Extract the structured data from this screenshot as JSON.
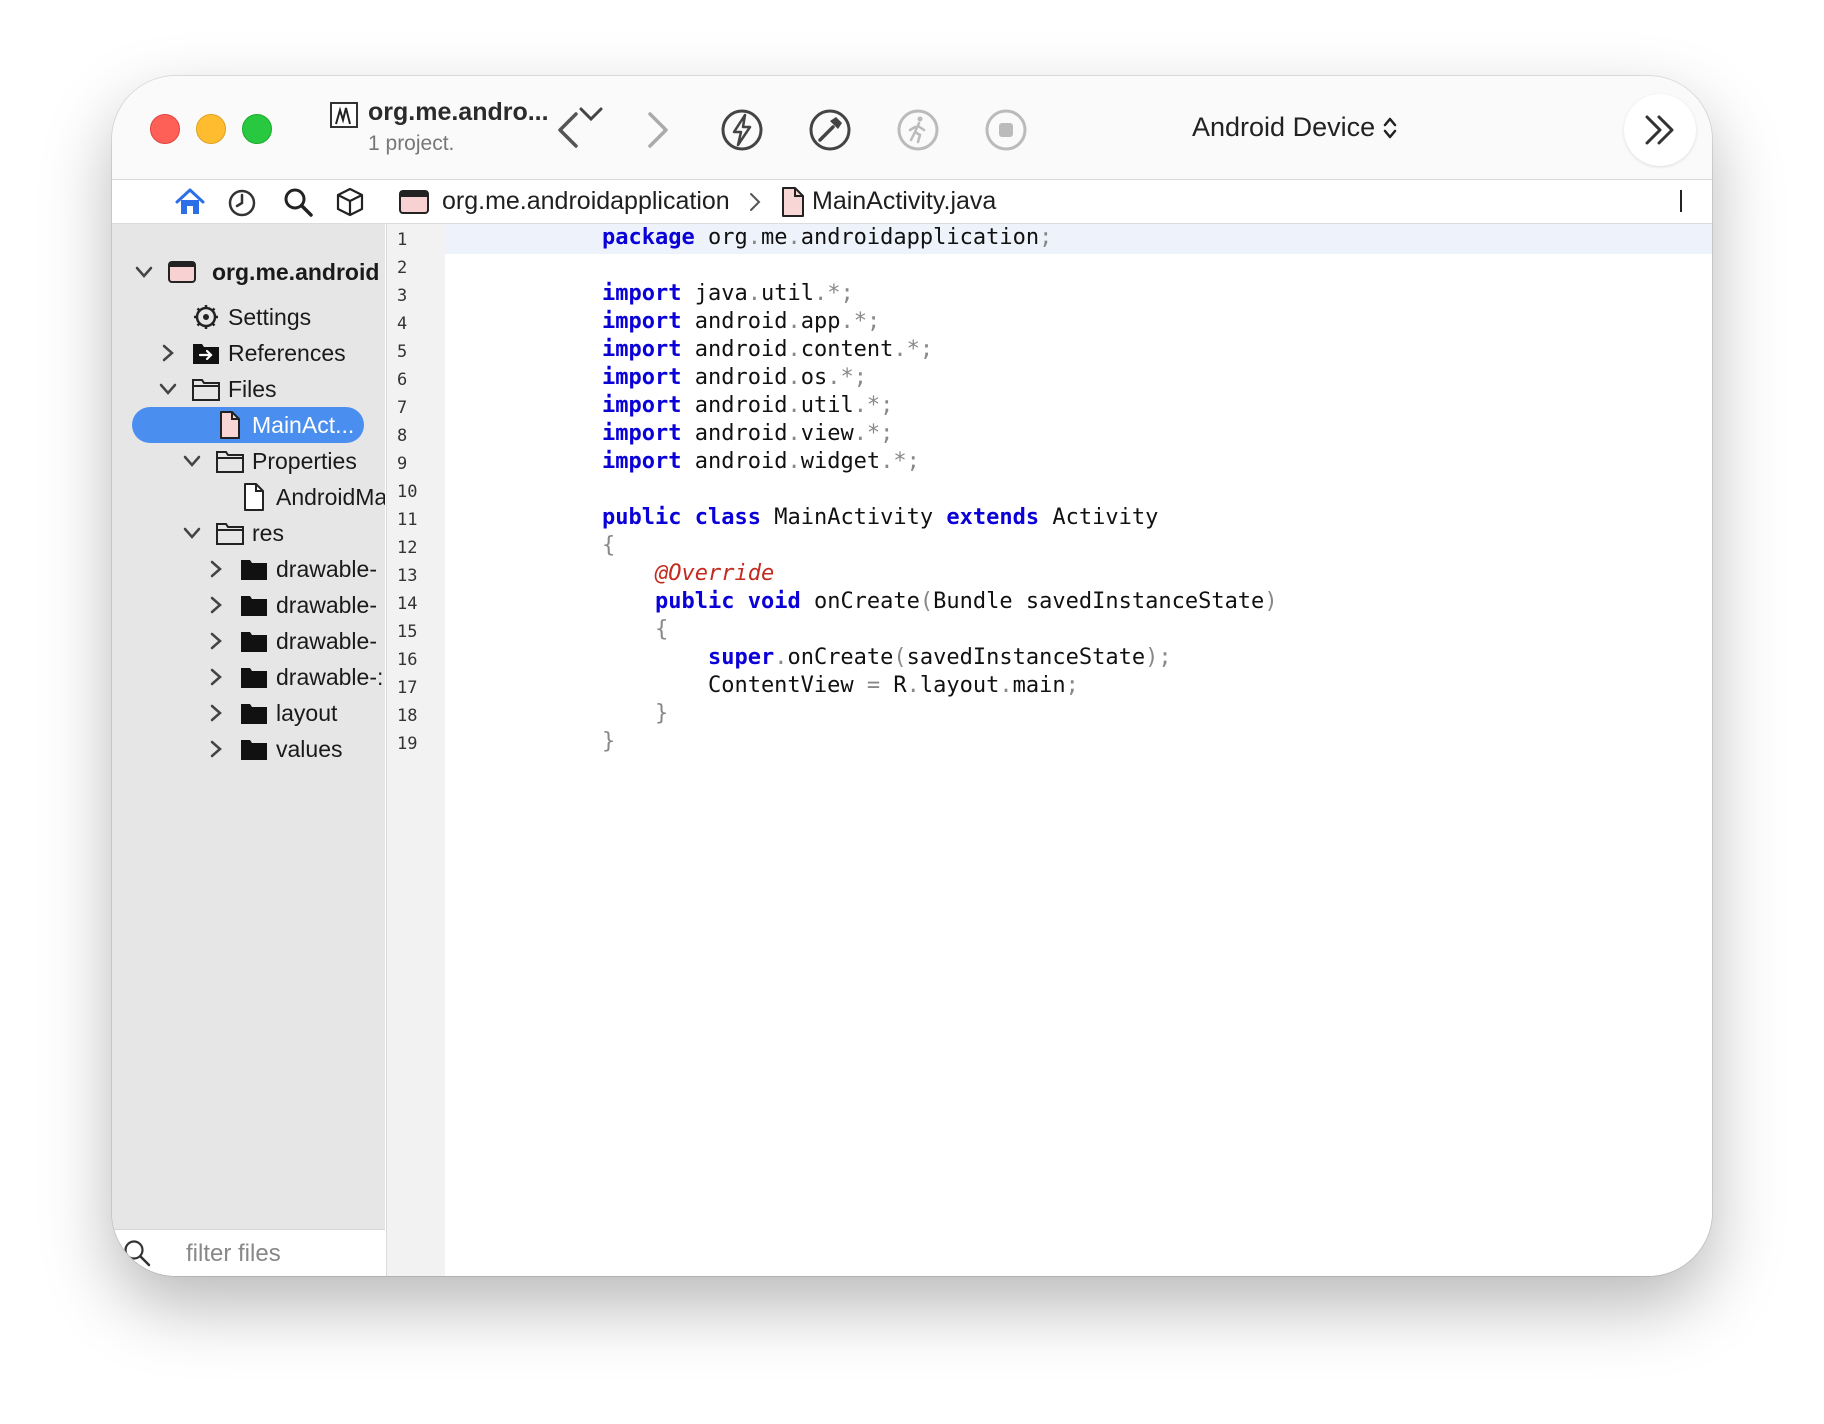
{
  "toolbar": {
    "project_name": "org.me.andro...",
    "project_subtitle": "1 project.",
    "device": "Android Device"
  },
  "breadcrumb": {
    "project": "org.me.androidapplication",
    "file": "MainActivity.java"
  },
  "sidebar": {
    "root": "org.me.android",
    "items": [
      {
        "label": "Settings"
      },
      {
        "label": "References"
      },
      {
        "label": "Files"
      },
      {
        "label": "MainAct..."
      },
      {
        "label": "Properties"
      },
      {
        "label": "AndroidMa"
      },
      {
        "label": "res"
      },
      {
        "label": "drawable-"
      },
      {
        "label": "drawable-"
      },
      {
        "label": "drawable-"
      },
      {
        "label": "drawable-:"
      },
      {
        "label": "layout"
      },
      {
        "label": "values"
      }
    ],
    "filter_placeholder": "filter files"
  },
  "editor": {
    "line_numbers": [
      "1",
      "2",
      "3",
      "4",
      "5",
      "6",
      "7",
      "8",
      "9",
      "10",
      "11",
      "12",
      "13",
      "14",
      "15",
      "16",
      "17",
      "18",
      "19"
    ],
    "code": {
      "l1": {
        "a": "package",
        "b": " org",
        "c": ".",
        "d": "me",
        "e": ".",
        "f": "androidapplication",
        "g": ";"
      },
      "l3": {
        "a": "import",
        "b": " java",
        "c": ".",
        "d": "util",
        "e": ".*;"
      },
      "l4": {
        "a": "import",
        "b": " android",
        "c": ".",
        "d": "app",
        "e": ".*;"
      },
      "l5": {
        "a": "import",
        "b": " android",
        "c": ".",
        "d": "content",
        "e": ".*;"
      },
      "l6": {
        "a": "import",
        "b": " android",
        "c": ".",
        "d": "os",
        "e": ".*;"
      },
      "l7": {
        "a": "import",
        "b": " android",
        "c": ".",
        "d": "util",
        "e": ".*;"
      },
      "l8": {
        "a": "import",
        "b": " android",
        "c": ".",
        "d": "view",
        "e": ".*;"
      },
      "l9": {
        "a": "import",
        "b": " android",
        "c": ".",
        "d": "widget",
        "e": ".*;"
      },
      "l11": {
        "a": "public",
        "b": " ",
        "c": "class",
        "d": " MainActivity ",
        "e": "extends",
        "f": " Activity"
      },
      "l12": {
        "a": "{"
      },
      "l13": {
        "a": "    ",
        "b": "@Override"
      },
      "l14": {
        "a": "    ",
        "b": "public",
        "c": " ",
        "d": "void",
        "e": " onCreate",
        "f": "(",
        "g": "Bundle savedInstanceState",
        "h": ")"
      },
      "l15": {
        "a": "    {"
      },
      "l16": {
        "a": "        ",
        "b": "super",
        "c": ".",
        "d": "onCreate",
        "e": "(",
        "f": "savedInstanceState",
        "g": ");"
      },
      "l17": {
        "a": "        ContentView ",
        "b": "=",
        "c": " R",
        "d": ".",
        "e": "layout",
        "f": ".",
        "g": "main",
        "h": ";"
      },
      "l18": {
        "a": "    }"
      },
      "l19": {
        "a": "}"
      }
    }
  },
  "colors": {
    "keyword": "#0a00d8",
    "annotation": "#c3291c",
    "selection": "#4a8ff0"
  },
  "icons": [
    "project-icon",
    "chevron-down-icon",
    "back-icon",
    "forward-icon",
    "lightning-icon",
    "hammer-icon",
    "run-icon",
    "stop-icon",
    "updown-icon",
    "double-chevron-icon",
    "home-icon",
    "clock-icon",
    "search-icon",
    "package-icon",
    "folder-icon",
    "file-icon",
    "gear-icon"
  ]
}
